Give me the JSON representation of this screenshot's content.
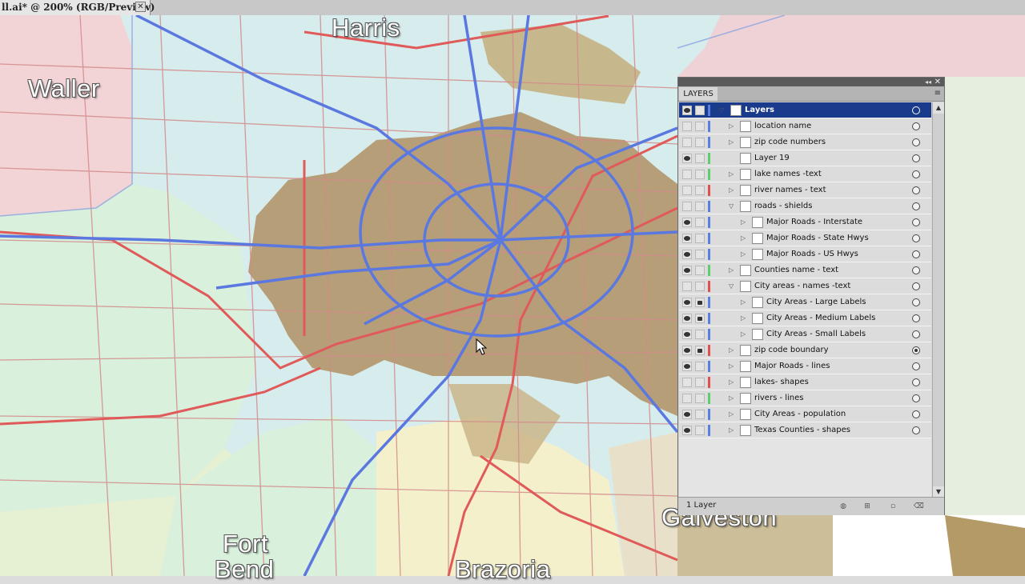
{
  "document_tab": {
    "title": "ll.ai* @ 200% (RGB/Preview)",
    "close_glyph": "✕"
  },
  "map": {
    "labels": [
      "Harris",
      "Waller",
      "Galveston",
      "Fort",
      "Bend",
      "Brazoria"
    ],
    "colors": {
      "county_a": "#f2d4d6",
      "county_b": "#d8eedd",
      "county_c": "#d7ecec",
      "city": "#b1966b",
      "interstate": "#5a78e0",
      "road": "#e06060",
      "minor": "#d48a8a"
    }
  },
  "layers_panel": {
    "tab_label": "LAYERS",
    "collapse_glyph": "◂◂",
    "close_glyph": "✕",
    "menu_glyph": "≡",
    "footer_text": "1 Layer",
    "scroll_up_glyph": "▲",
    "scroll_down_glyph": "▼",
    "footer_icons": [
      "make-clipping-mask-icon",
      "create-sublayer-icon",
      "new-layer-icon",
      "delete-layer-icon"
    ],
    "rows": [
      {
        "name": "Layers",
        "visible": true,
        "locked": false,
        "color": "#5b7fe0",
        "expanded": true,
        "indent": 0,
        "selected": true,
        "targeted": false
      },
      {
        "name": "location name",
        "visible": false,
        "locked": false,
        "color": "#5b7fe0",
        "expanded": false,
        "indent": 1,
        "targeted": false
      },
      {
        "name": "zip code numbers",
        "visible": false,
        "locked": false,
        "color": "#5b7fe0",
        "expanded": false,
        "indent": 1,
        "targeted": false
      },
      {
        "name": "Layer 19",
        "visible": true,
        "locked": false,
        "color": "#5bd06a",
        "expanded": null,
        "indent": 1,
        "targeted": false
      },
      {
        "name": "lake names -text",
        "visible": false,
        "locked": false,
        "color": "#5bd06a",
        "expanded": false,
        "indent": 1,
        "targeted": false
      },
      {
        "name": "river names - text",
        "visible": false,
        "locked": false,
        "color": "#e05050",
        "expanded": false,
        "indent": 1,
        "targeted": false
      },
      {
        "name": "roads - shields",
        "visible": false,
        "locked": false,
        "color": "#5b7fe0",
        "expanded": true,
        "indent": 1,
        "targeted": false
      },
      {
        "name": "Major Roads - Interstate",
        "visible": true,
        "locked": false,
        "color": "#5b7fe0",
        "expanded": false,
        "indent": 2,
        "targeted": false
      },
      {
        "name": "Major Roads - State Hwys",
        "visible": true,
        "locked": false,
        "color": "#5b7fe0",
        "expanded": false,
        "indent": 2,
        "targeted": false
      },
      {
        "name": "Major Roads - US Hwys",
        "visible": true,
        "locked": false,
        "color": "#5b7fe0",
        "expanded": false,
        "indent": 2,
        "targeted": false
      },
      {
        "name": "Counties name - text",
        "visible": true,
        "locked": false,
        "color": "#5bd06a",
        "expanded": false,
        "indent": 1,
        "targeted": false
      },
      {
        "name": "City areas - names -text",
        "visible": false,
        "locked": false,
        "color": "#e05050",
        "expanded": true,
        "indent": 1,
        "targeted": false
      },
      {
        "name": "City Areas - Large Labels",
        "visible": true,
        "locked": true,
        "color": "#5b7fe0",
        "expanded": false,
        "indent": 2,
        "targeted": false
      },
      {
        "name": "City Areas - Medium Labels",
        "visible": true,
        "locked": true,
        "color": "#5b7fe0",
        "expanded": false,
        "indent": 2,
        "targeted": false
      },
      {
        "name": "City Areas - Small Labels",
        "visible": true,
        "locked": false,
        "color": "#5b7fe0",
        "expanded": false,
        "indent": 2,
        "targeted": false
      },
      {
        "name": "zip code boundary",
        "visible": true,
        "locked": true,
        "color": "#e05050",
        "expanded": false,
        "indent": 1,
        "targeted": true
      },
      {
        "name": "Major Roads - lines",
        "visible": true,
        "locked": false,
        "color": "#5b7fe0",
        "expanded": false,
        "indent": 1,
        "targeted": false
      },
      {
        "name": "lakes- shapes",
        "visible": false,
        "locked": false,
        "color": "#e05050",
        "expanded": false,
        "indent": 1,
        "targeted": false
      },
      {
        "name": "rivers - lines",
        "visible": false,
        "locked": false,
        "color": "#5bd06a",
        "expanded": false,
        "indent": 1,
        "targeted": false
      },
      {
        "name": "City Areas - population",
        "visible": true,
        "locked": false,
        "color": "#5b7fe0",
        "expanded": false,
        "indent": 1,
        "targeted": false
      },
      {
        "name": "Texas Counties - shapes",
        "visible": true,
        "locked": false,
        "color": "#5b7fe0",
        "expanded": false,
        "indent": 1,
        "targeted": false
      }
    ]
  }
}
